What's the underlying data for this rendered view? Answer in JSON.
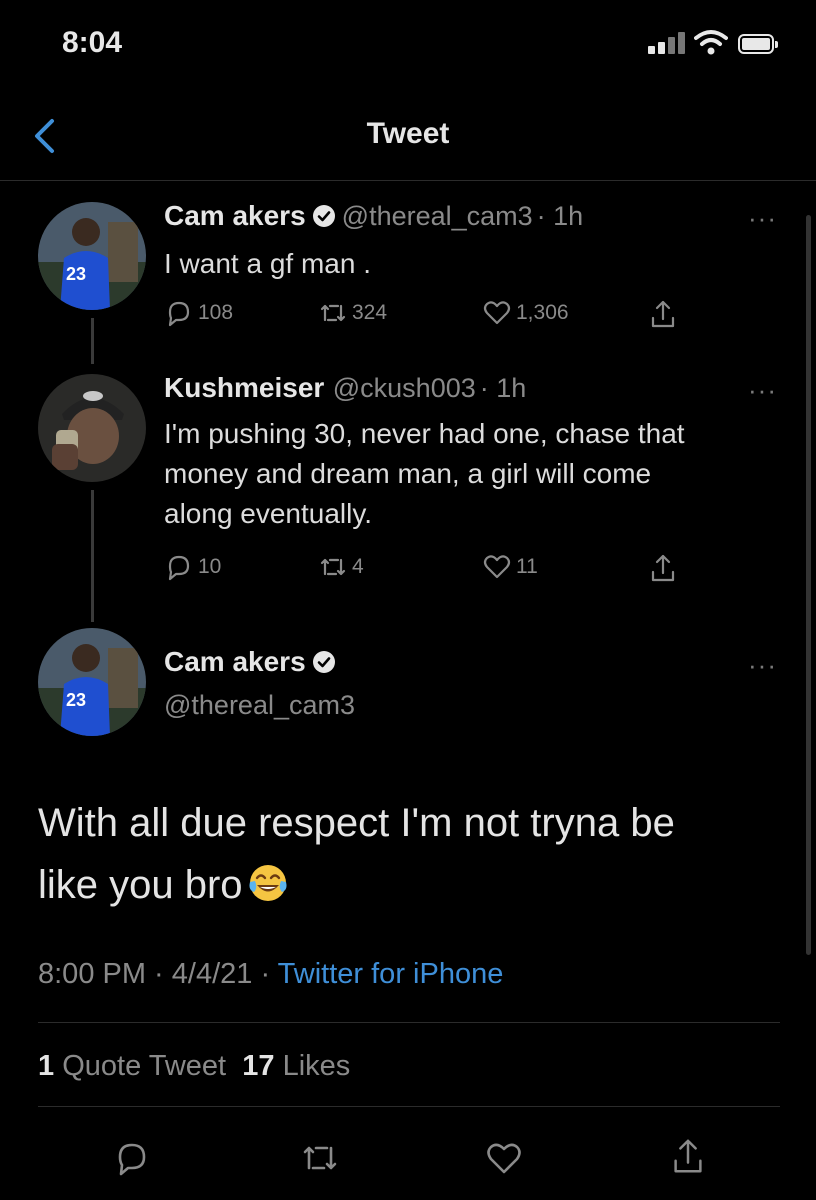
{
  "status_bar": {
    "time": "8:04"
  },
  "header": {
    "title": "Tweet"
  },
  "tweets": [
    {
      "name": "Cam akers",
      "verified": true,
      "handle": "@thereal_cam3",
      "time": "· 1h",
      "text": "I want a gf man .",
      "replies": "108",
      "retweets": "324",
      "likes": "1,306",
      "more": "···"
    },
    {
      "name": "Kushmeiser",
      "verified": false,
      "handle": "@ckush003",
      "time": "· 1h",
      "text_lines": [
        "I'm pushing 30, never had one, chase that",
        "money and dream man, a girl will come",
        "along eventually."
      ],
      "replies": "10",
      "retweets": "4",
      "likes": "11",
      "more": "···"
    }
  ],
  "main_tweet": {
    "name": "Cam akers",
    "handle": "@thereal_cam3",
    "line1": "With all due respect I'm not tryna be",
    "line2": "like you bro",
    "emoji": "face-with-tears-of-joy",
    "time": "8:00 PM",
    "date": "4/4/21",
    "source": "Twitter for iPhone",
    "quote_count": "1",
    "quote_label": "Quote Tweet",
    "like_count": "17",
    "like_label": "Likes",
    "more": "···"
  },
  "colors": {
    "background": "#000000",
    "link": "#3f8fd8",
    "muted": "#8a8a8a"
  }
}
